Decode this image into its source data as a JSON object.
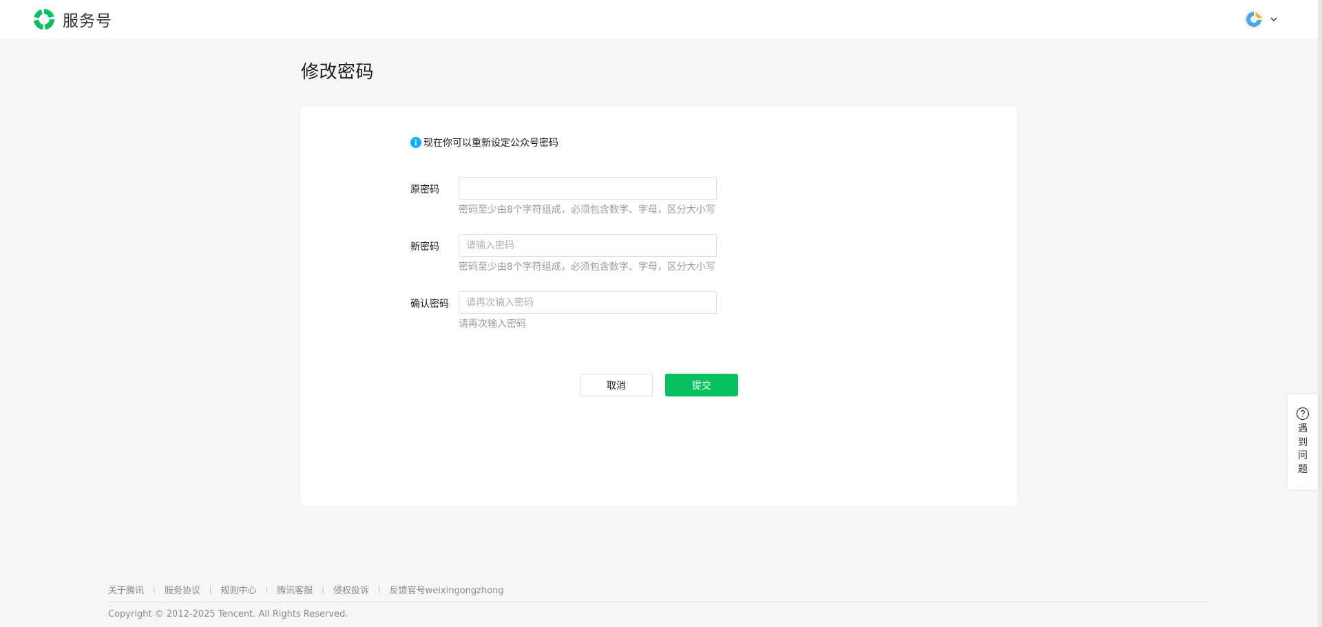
{
  "header": {
    "brand_name": "服务号",
    "brand_color": "#07c160"
  },
  "page": {
    "title": "修改密码"
  },
  "form": {
    "notice": "现在你可以重新设定公众号密码",
    "fields": [
      {
        "label": "原密码",
        "value": "",
        "placeholder": "",
        "hint": "密码至少由8个字符组成，必须包含数字、字母，区分大小写"
      },
      {
        "label": "新密码",
        "value": "",
        "placeholder": "请输入密码",
        "hint": "密码至少由8个字符组成，必须包含数字、字母，区分大小写"
      },
      {
        "label": "确认密码",
        "value": "",
        "placeholder": "请再次输入密码",
        "hint": "请再次输入密码"
      }
    ],
    "cancel_label": "取消",
    "submit_label": "提交",
    "submit_color": "#07c160"
  },
  "help": {
    "label": "遇到问题"
  },
  "footer": {
    "links": [
      "关于腾讯",
      "服务协议",
      "规则中心",
      "腾讯客服",
      "侵权投诉",
      "反馈官号weixingongzhong"
    ],
    "separator": "|",
    "copyright": "Copyright © 2012-2025 Tencent. All Rights Reserved."
  },
  "icons": {
    "brand_logo": "service-account-logo-icon",
    "avatar": "avatar-icon",
    "account_menu": "chevron-down-icon",
    "notice": "info-icon",
    "help": "question-circle-icon"
  }
}
